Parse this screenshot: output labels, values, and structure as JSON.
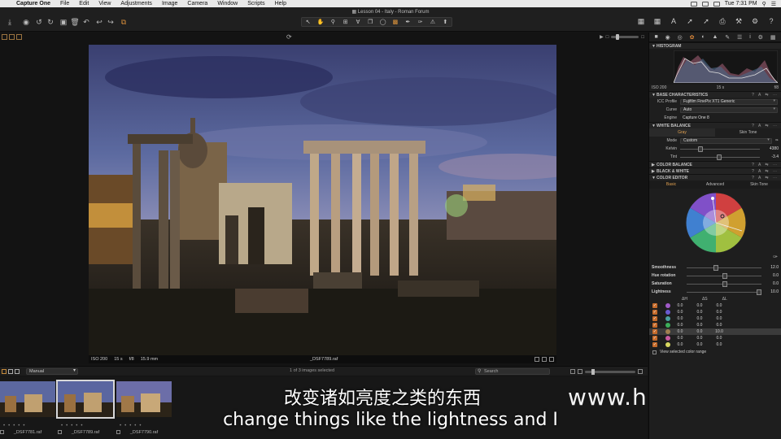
{
  "menubar": {
    "app": "Capture One",
    "items": [
      "File",
      "Edit",
      "View",
      "Adjustments",
      "Image",
      "Camera",
      "Window",
      "Scripts",
      "Help"
    ],
    "clock": "Tue 7:31 PM"
  },
  "document": {
    "title": "Lesson 04 - Italy - Roman Forum"
  },
  "photo_info": {
    "iso": "ISO 200",
    "shutter": "15 s",
    "aperture": "f/8",
    "focal": "15.9 mm",
    "filename": "_DSF7789.raf"
  },
  "browser": {
    "sort": "Manual",
    "selection_status": "1 of 3 images selected",
    "search_placeholder": "Search"
  },
  "thumbnails": [
    {
      "name": "_DSF7781.raf"
    },
    {
      "name": "_DSF7789.raf"
    },
    {
      "name": "_DSF7790.raf"
    }
  ],
  "subtitles": {
    "cn": "改变诸如亮度之类的东西",
    "en": "change things like the lightness and I"
  },
  "watermark": "www.hunls.com",
  "inspector": {
    "histogram": {
      "title": "HISTOGRAM",
      "iso": "ISO 200",
      "shutter": "15 s",
      "aperture": "f/8"
    },
    "base": {
      "title": "BASE CHARACTERISTICS",
      "icc_label": "ICC Profile",
      "icc_value": "Fujifilm FinePix XT1 Generic",
      "curve_label": "Curve",
      "curve_value": "Auto",
      "engine_label": "Engine",
      "engine_value": "Capture One 8"
    },
    "white_balance": {
      "title": "WHITE BALANCE",
      "tab_gray": "Gray",
      "tab_skin": "Skin Tone",
      "mode_label": "Mode",
      "mode_value": "Custom",
      "kelvin_label": "Kelvin",
      "kelvin_value": "4380",
      "tint_label": "Tint",
      "tint_value": "-3.4"
    },
    "color_balance": {
      "title": "COLOR BALANCE"
    },
    "black_white": {
      "title": "BLACK & WHITE"
    },
    "color_editor": {
      "title": "COLOR EDITOR",
      "tabs": [
        "Basic",
        "Advanced",
        "Skin Tone"
      ],
      "smoothness_label": "Smoothness",
      "smoothness_value": "12.0",
      "hue_label": "Hue rotation",
      "hue_value": "0.0",
      "sat_label": "Saturation",
      "sat_value": "0.0",
      "light_label": "Lightness",
      "light_value": "10.0",
      "table_headers": [
        "ΔH",
        "ΔS",
        "ΔL"
      ],
      "rows": [
        {
          "color": "#a05ac8",
          "h": "0.0",
          "s": "0.0",
          "l": "0.0"
        },
        {
          "color": "#6a5ad0",
          "h": "0.0",
          "s": "0.0",
          "l": "0.0"
        },
        {
          "color": "#4aa0a0",
          "h": "0.0",
          "s": "0.0",
          "l": "0.0"
        },
        {
          "color": "#3cae5a",
          "h": "0.0",
          "s": "0.0",
          "l": "0.0"
        },
        {
          "color": "#a08050",
          "h": "0.0",
          "s": "0.0",
          "l": "10.0"
        },
        {
          "color": "#c85aa0",
          "h": "0.0",
          "s": "0.0",
          "l": "0.0"
        },
        {
          "color": "#d8d860",
          "h": "0.0",
          "s": "0.0",
          "l": "0.0"
        }
      ],
      "view_selected": "View selected color range"
    }
  }
}
